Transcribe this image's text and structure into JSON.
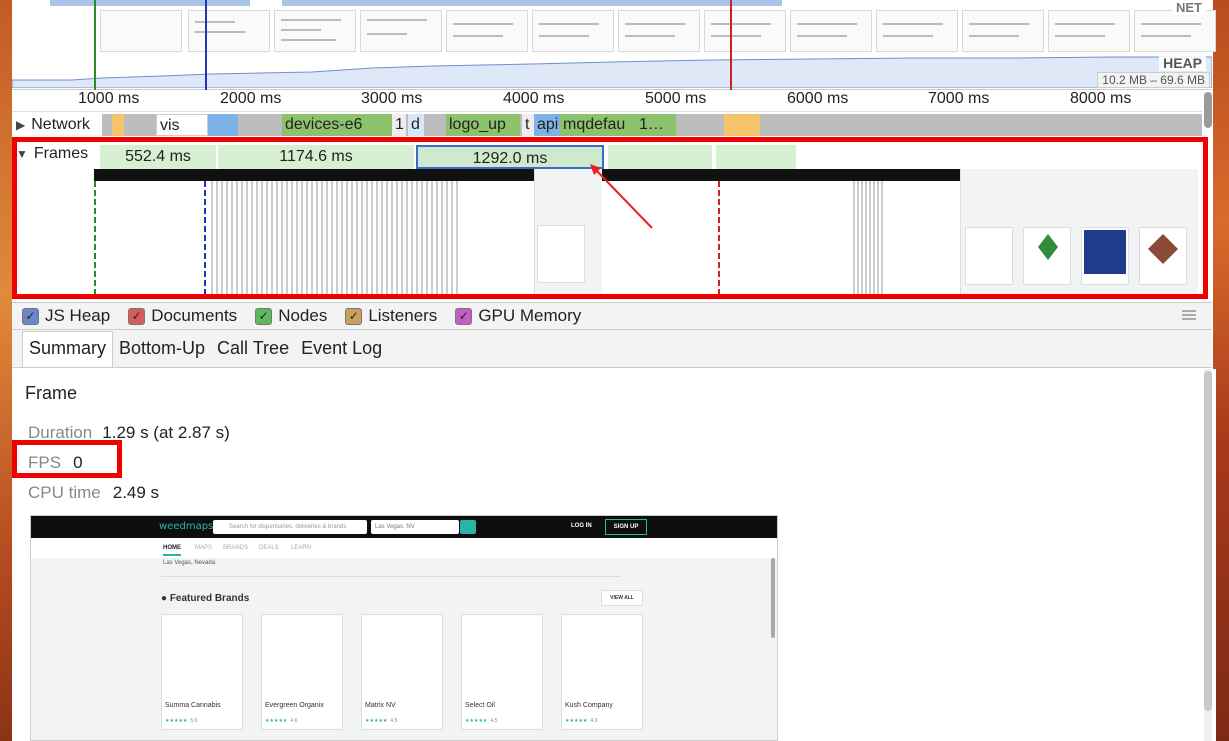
{
  "overview": {
    "net_label": "NET",
    "heap_label": "HEAP",
    "heap_range": "10.2 MB – 69.6 MB"
  },
  "ruler": {
    "ticks": [
      "1000 ms",
      "2000 ms",
      "3000 ms",
      "4000 ms",
      "5000 ms",
      "6000 ms",
      "7000 ms",
      "8000 ms"
    ]
  },
  "network": {
    "label": "Network",
    "segments": [
      "vis",
      "devices-e6",
      "1",
      "d",
      "logo_up",
      "t",
      "api",
      "mqdefau",
      "1…"
    ]
  },
  "frames": {
    "label": "Frames",
    "bars": [
      "552.4 ms",
      "1174.6 ms",
      "1292.0 ms"
    ]
  },
  "counters": {
    "items": [
      {
        "label": "JS Heap",
        "color": "#6f85c9"
      },
      {
        "label": "Documents",
        "color": "#d65d5d"
      },
      {
        "label": "Nodes",
        "color": "#5cb85c"
      },
      {
        "label": "Listeners",
        "color": "#c9a060"
      },
      {
        "label": "GPU Memory",
        "color": "#c55ec7"
      }
    ]
  },
  "tabs": [
    "Summary",
    "Bottom-Up",
    "Call Tree",
    "Event Log"
  ],
  "summary": {
    "title": "Frame",
    "duration_label": "Duration",
    "duration_value": "1.29 s (at 2.87 s)",
    "fps_label": "FPS",
    "fps_value": "0",
    "cpu_label": "CPU time",
    "cpu_value": "2.49 s"
  },
  "screenshot": {
    "logo": "weedmaps",
    "search_placeholder": "Search for dispensaries, deliveries & brands",
    "location": "Las Vegas, NV",
    "login": "LOG IN",
    "signup": "SIGN UP",
    "nav": [
      "HOME",
      "MAPS",
      "BRANDS",
      "DEALS",
      "LEARN"
    ],
    "city": "Las Vegas, Nevada",
    "featured": "Featured Brands",
    "view_all": "VIEW ALL",
    "brands": [
      {
        "name": "Summa Cannabis",
        "rating": "5.0"
      },
      {
        "name": "Evergreen Organix",
        "rating": "4.6"
      },
      {
        "name": "Matrix NV",
        "rating": "4.5"
      },
      {
        "name": "Select Oil",
        "rating": "4.5"
      },
      {
        "name": "Kush Company",
        "rating": "4.9"
      }
    ]
  }
}
